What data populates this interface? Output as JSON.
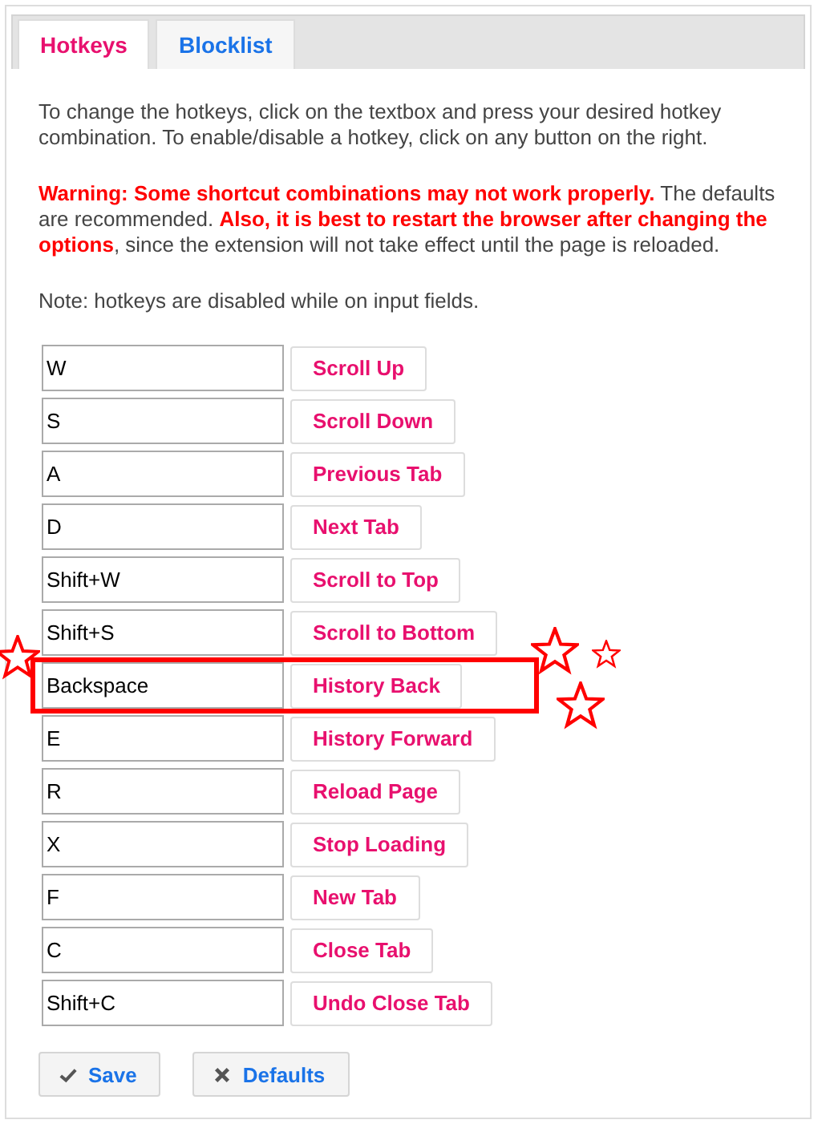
{
  "tabs": [
    {
      "label": "Hotkeys",
      "selected": true
    },
    {
      "label": "Blocklist",
      "selected": false
    }
  ],
  "intro": "To change the hotkeys, click on the textbox and press your desired hotkey combination. To enable/disable a hotkey, click on any button on the right.",
  "warning": "**Warning: Some shortcut combinations may not work properly.** The defaults are recommended. **Also, it is best to restart the browser after changing the options**, since the extension will not take effect until the page is reloaded.",
  "note": "Note: hotkeys are disabled while on input fields.",
  "hotkeys": [
    {
      "key": "W",
      "action": "Scroll Up",
      "highlighted": false
    },
    {
      "key": "S",
      "action": "Scroll Down",
      "highlighted": false
    },
    {
      "key": "A",
      "action": "Previous Tab",
      "highlighted": false
    },
    {
      "key": "D",
      "action": "Next Tab",
      "highlighted": false
    },
    {
      "key": "Shift+W",
      "action": "Scroll to Top",
      "highlighted": false
    },
    {
      "key": "Shift+S",
      "action": "Scroll to Bottom",
      "highlighted": false
    },
    {
      "key": "Backspace",
      "action": "History Back",
      "highlighted": true
    },
    {
      "key": "E",
      "action": "History Forward",
      "highlighted": false
    },
    {
      "key": "R",
      "action": "Reload Page",
      "highlighted": false
    },
    {
      "key": "X",
      "action": "Stop Loading",
      "highlighted": false
    },
    {
      "key": "F",
      "action": "New Tab",
      "highlighted": false
    },
    {
      "key": "C",
      "action": "Close Tab",
      "highlighted": false
    },
    {
      "key": "Shift+C",
      "action": "Undo Close Tab",
      "highlighted": false
    }
  ],
  "buttons": [
    {
      "kind": "save",
      "label": "Save"
    },
    {
      "kind": "defaults",
      "label": "Defaults"
    }
  ]
}
